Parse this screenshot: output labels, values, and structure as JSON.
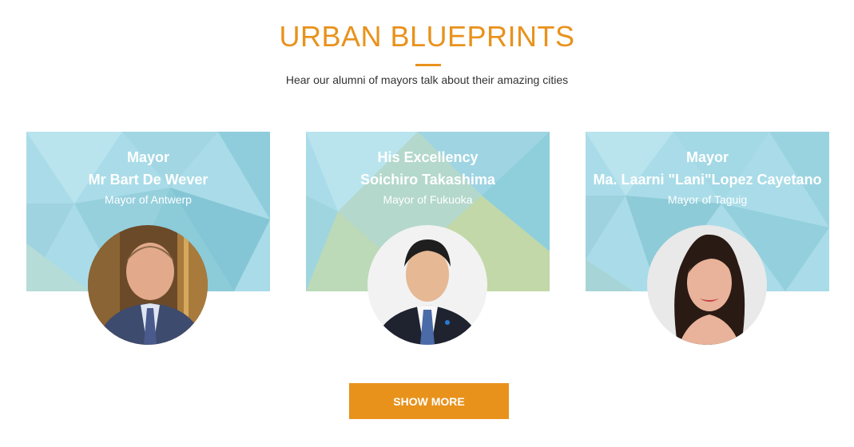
{
  "section": {
    "title": "URBAN BLUEPRINTS",
    "subtitle": "Hear our alumni of mayors talk about their amazing cities"
  },
  "colors": {
    "accent": "#e8921c",
    "card_background": "#a7dbe6",
    "text_on_card": "#ffffff"
  },
  "mayors": [
    {
      "honorific": "Mayor",
      "name": "Mr Bart De Wever",
      "role": "Mayor of Antwerp",
      "photo": "portrait-photo"
    },
    {
      "honorific": "His Excellency",
      "name": "Soichiro Takashima",
      "role": "Mayor of Fukuoka",
      "photo": "portrait-photo"
    },
    {
      "honorific": "Mayor",
      "name": "Ma. Laarni \"Lani\"Lopez Cayetano",
      "role": "Mayor of Taguig",
      "photo": "portrait-photo"
    }
  ],
  "actions": {
    "show_more_label": "SHOW MORE"
  }
}
